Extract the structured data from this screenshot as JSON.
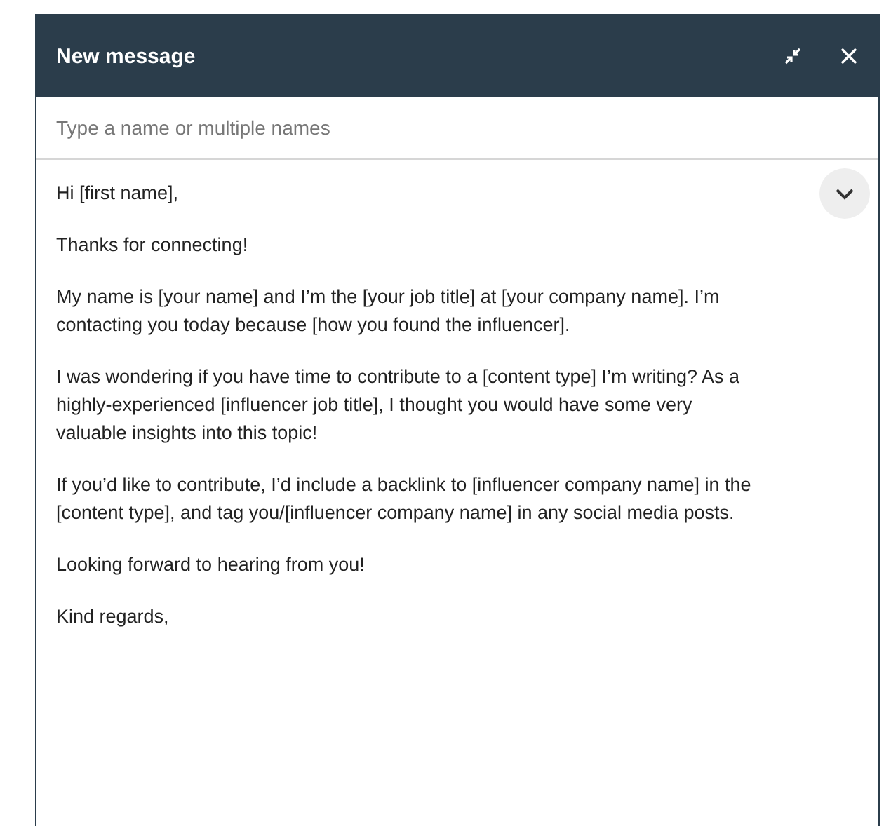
{
  "window": {
    "title": "New message"
  },
  "recipient": {
    "placeholder": "Type a name or multiple names"
  },
  "body": [
    "Hi [first name],",
    "Thanks for connecting!",
    "My name is [your name] and I’m the [your job title] at [your company name]. I’m contacting you today because [how you found the influencer].",
    "I was wondering if you have time to contribute to a [content type] I’m writing? As a highly-experienced [influencer job title], I thought you would have some very valuable insights into this topic!",
    "If you’d like to contribute, I’d include a backlink to [influencer company name] in the [content type], and tag you/[influencer company name] in any social media posts.",
    "Looking forward to hearing from you!",
    "Kind regards,"
  ]
}
